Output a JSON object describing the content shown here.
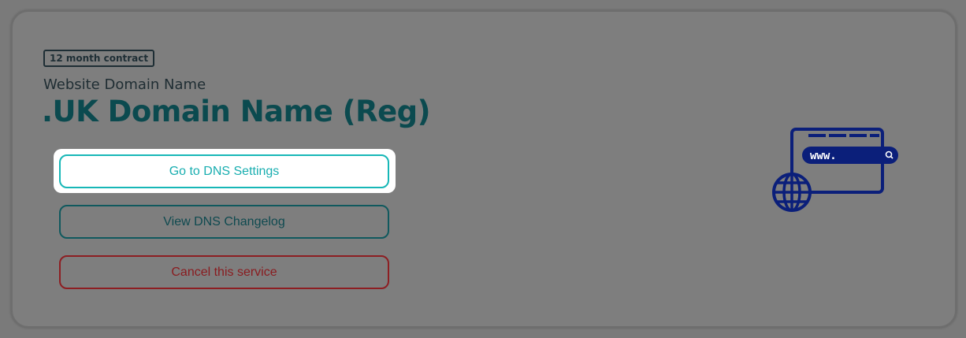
{
  "service": {
    "badge": "12 month contract",
    "subtitle": "Website Domain Name",
    "title": ".UK Domain Name (Reg)"
  },
  "actions": {
    "dns_settings_label": "Go to DNS Settings",
    "dns_changelog_label": "View DNS Changelog",
    "cancel_label": "Cancel this service"
  },
  "illustration": {
    "address_text": "www.",
    "icon": "browser-globe-icon"
  },
  "colors": {
    "primary_teal": "#19aeb0",
    "dark_teal": "#0b4a4f",
    "danger_red": "#8a1b1f",
    "illustration_navy": "#0b1f7a"
  }
}
